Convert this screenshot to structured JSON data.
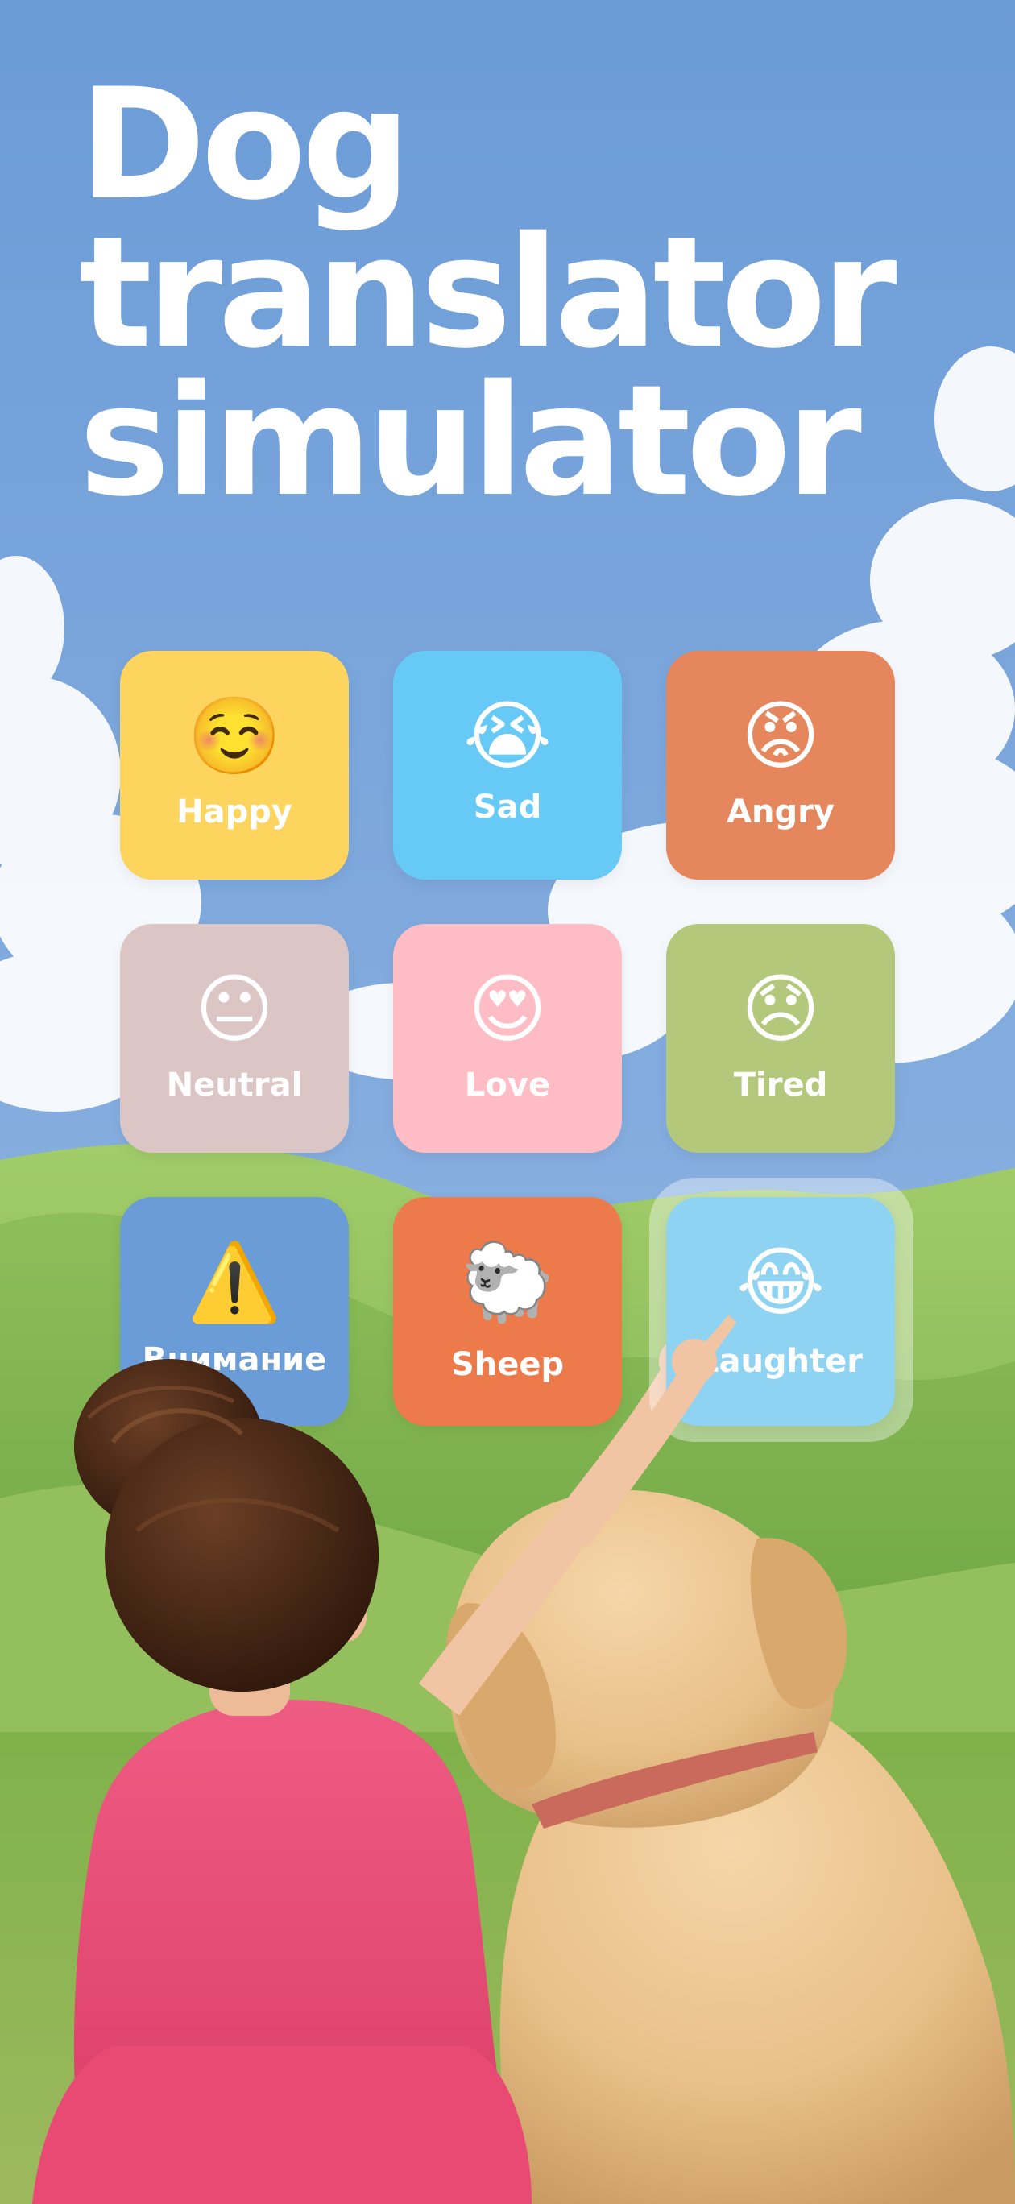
{
  "title": {
    "line1": "Dog",
    "line2": "translator",
    "line3": "simulator"
  },
  "emotions": [
    {
      "id": "happy",
      "label": "Happy",
      "emoji": "☺️",
      "color": "#FDD55E"
    },
    {
      "id": "sad",
      "label": "Sad",
      "emoji": "😭",
      "color": "#66C9F6"
    },
    {
      "id": "angry",
      "label": "Angry",
      "emoji": "😡",
      "color": "#E6865D"
    },
    {
      "id": "neutral",
      "label": "Neutral",
      "emoji": "😐",
      "color": "#DCC5C5"
    },
    {
      "id": "love",
      "label": "Love",
      "emoji": "😍",
      "color": "#FEBDC5"
    },
    {
      "id": "tired",
      "label": "Tired",
      "emoji": "😞",
      "color": "#B4C87C"
    },
    {
      "id": "attention",
      "label": "Внимание",
      "emoji": "⚠️",
      "color": "#6A9CD8"
    },
    {
      "id": "sheep",
      "label": "Sheep",
      "emoji": "🐑",
      "color": "#EC7A4A"
    },
    {
      "id": "laughter",
      "label": "Laughter",
      "emoji": "😂",
      "color": "#8ED3F2"
    }
  ],
  "colors": {
    "sky_top": "#6B9BD7",
    "sky_bottom": "#A9C8E6",
    "hills": "#86B54E",
    "title_text": "#FFFFFF"
  }
}
